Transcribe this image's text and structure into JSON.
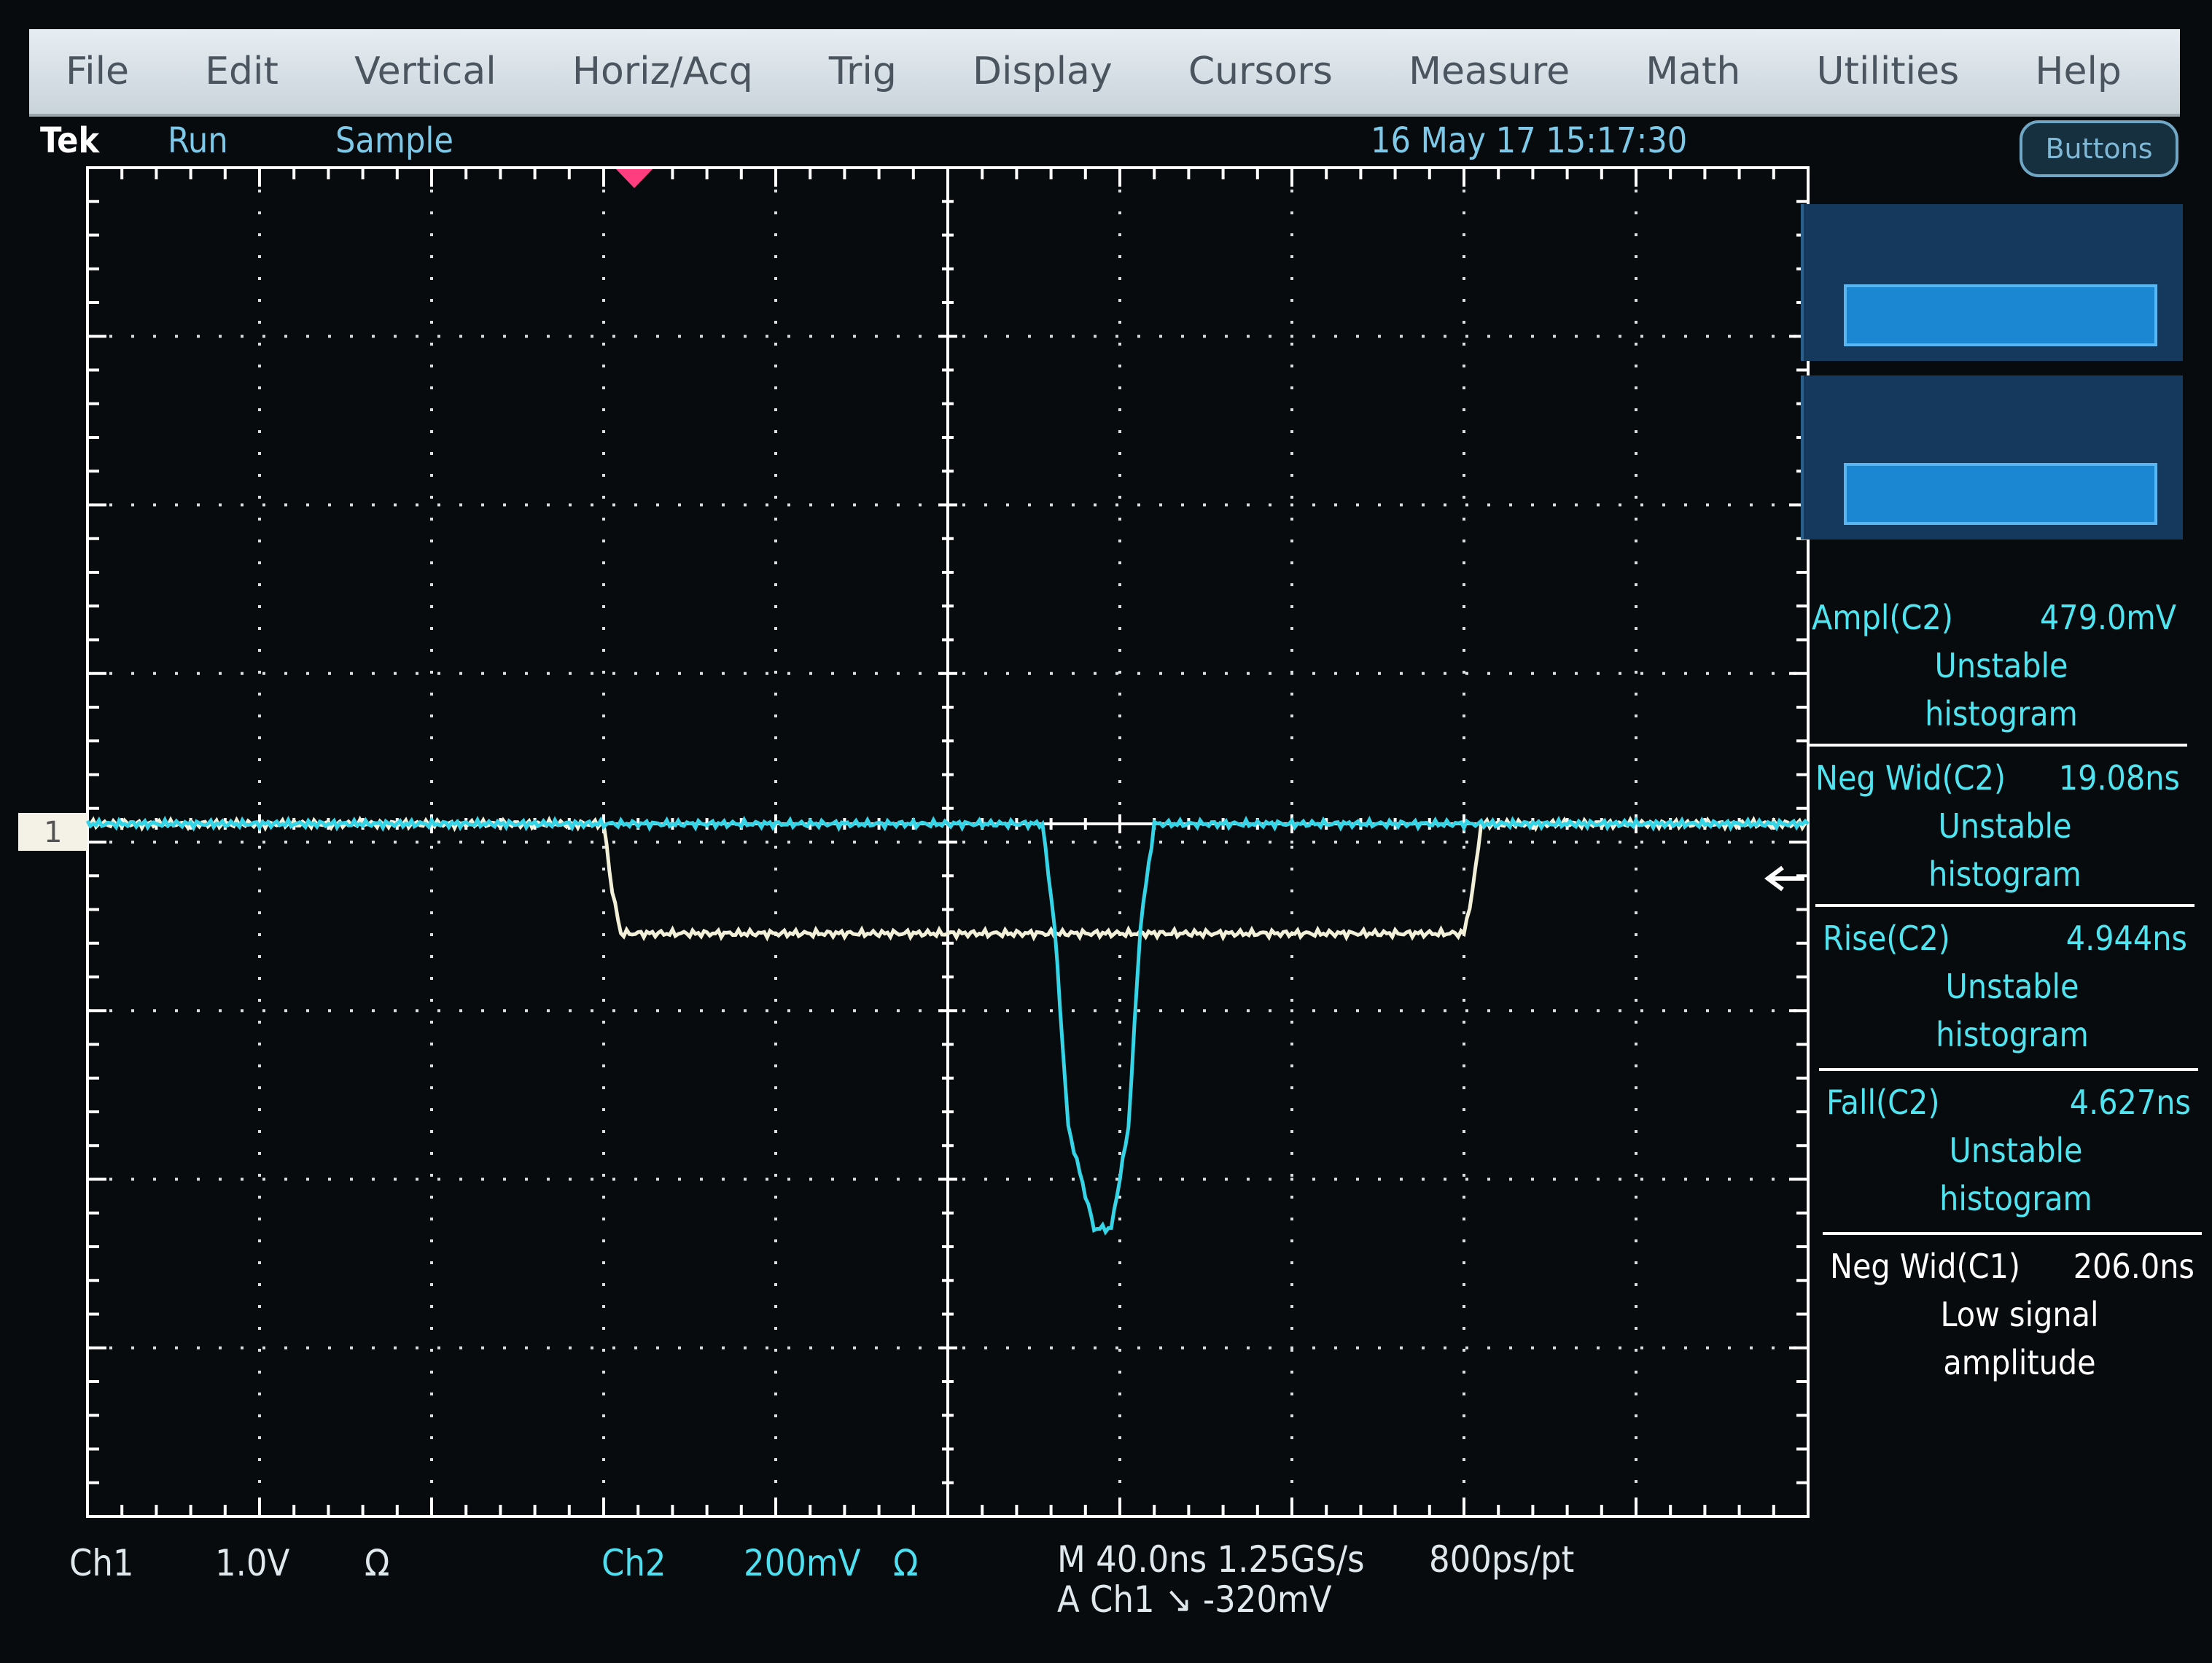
{
  "menu": [
    "File",
    "Edit",
    "Vertical",
    "Horiz/Acq",
    "Trig",
    "Display",
    "Cursors",
    "Measure",
    "Math",
    "Utilities",
    "Help"
  ],
  "status": {
    "brand": "Tek",
    "run_state": "Run",
    "acq_mode": "Sample",
    "datetime": "16 May 17 15:17:30",
    "buttons_label": "Buttons"
  },
  "ch1_marker": "1",
  "measurements": [
    {
      "label": "Ampl(C2)",
      "value": "479.0mV",
      "line2": "Unstable",
      "line3": "histogram"
    },
    {
      "label": "Neg Wid(C2)",
      "value": "19.08ns",
      "line2": "Unstable",
      "line3": "histogram"
    },
    {
      "label": "Rise(C2)",
      "value": "4.944ns",
      "line2": "Unstable",
      "line3": "histogram"
    },
    {
      "label": "Fall(C2)",
      "value": "4.627ns",
      "line2": "Unstable",
      "line3": "histogram"
    },
    {
      "label": "Neg Wid(C1)",
      "value": "206.0ns",
      "line2": "Low signal",
      "line3": "amplitude"
    }
  ],
  "readouts": {
    "ch1_label": "Ch1",
    "ch1_scale": "1.0V",
    "ch1_coupling": "Ω",
    "ch2_label": "Ch2",
    "ch2_scale": "200mV",
    "ch2_coupling": "Ω",
    "timebase": "M 40.0ns 1.25GS/s",
    "record": "800ps/pt",
    "trigger": "A Ch1 ↘ -320mV"
  },
  "colors": {
    "ch1": "#f2f0d8",
    "ch2": "#35d4e6",
    "trigger_marker": "#ff3d7f"
  },
  "chart_data": {
    "type": "line",
    "series": [
      {
        "name": "Ch1",
        "x_div": [
          -5,
          -2,
          -1.95,
          -1.9,
          3.0,
          3.05,
          3.1,
          5
        ],
        "y_div": [
          0,
          0,
          -0.4,
          -0.65,
          -0.65,
          -0.4,
          0,
          0
        ]
      },
      {
        "name": "Ch2",
        "x_div": [
          -5,
          0.55,
          0.62,
          0.7,
          0.85,
          0.95,
          1.05,
          1.12,
          1.2,
          5
        ],
        "y_div": [
          0,
          0,
          -0.6,
          -1.8,
          -2.4,
          -2.4,
          -1.8,
          -0.6,
          0,
          0
        ]
      }
    ],
    "xlim": [
      -5,
      5
    ],
    "ylim": [
      -4,
      4
    ],
    "grid": true
  }
}
